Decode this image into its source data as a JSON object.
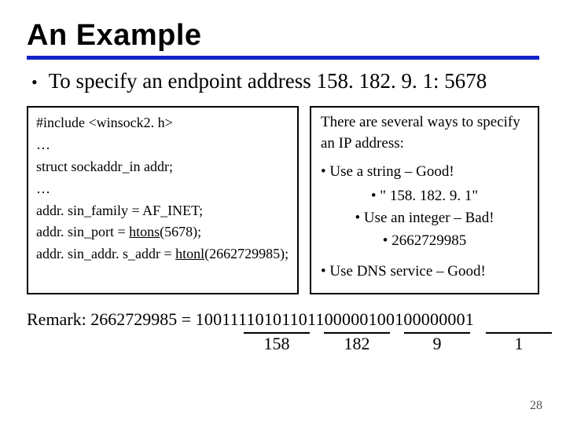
{
  "title": "An Example",
  "bullet": "To specify an endpoint address 158. 182. 9. 1: 5678",
  "code": {
    "l1": "#include <winsock2. h>",
    "l2": "…",
    "l3": "struct sockaddr_in addr;",
    "l4": "…",
    "l5": "addr. sin_family = AF_INET;",
    "l6_pre": "addr. sin_port = ",
    "l6_fn": "htons",
    "l6_post": "(5678);",
    "l7_pre": "addr. sin_addr. s_addr = ",
    "l7_fn": "htonl",
    "l7_post": "(2662729985);"
  },
  "notes": {
    "lead": "There are several ways to specify an IP address:",
    "p1": "• Use a string – Good!",
    "s1": "• \" 158. 182. 9. 1\"",
    "p2": "• Use an integer – Bad!",
    "s2": "• 2662729985",
    "p3": "• Use DNS service – Good!"
  },
  "remark": {
    "line1_pre": "Remark: 2662729985 = ",
    "binary": "10011110101101100000100100000001",
    "seg1": "158",
    "seg2": "182",
    "seg3": "9",
    "seg4": "1"
  },
  "page": "28"
}
